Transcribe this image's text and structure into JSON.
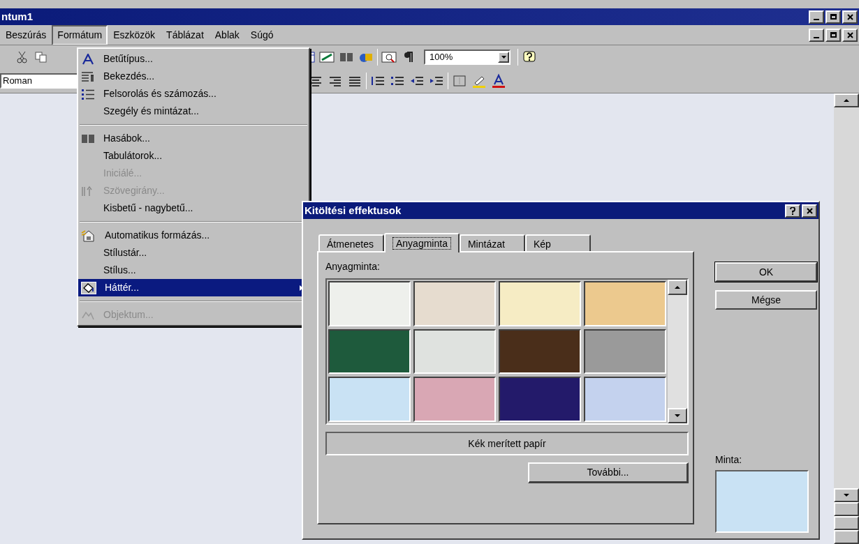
{
  "window": {
    "title": "ntum1"
  },
  "menu_bar": [
    {
      "label": "Beszúrás",
      "selected": false
    },
    {
      "label": "Formátum",
      "selected": true
    },
    {
      "label": "Eszközök",
      "selected": false
    },
    {
      "label": "Táblázat",
      "selected": false
    },
    {
      "label": "Ablak",
      "selected": false
    },
    {
      "label": "Súgó",
      "selected": false
    }
  ],
  "toolbar": {
    "font": "Roman",
    "zoom": "100%"
  },
  "format_menu": [
    {
      "items": [
        {
          "label": "Betűtípus...",
          "kind": "font",
          "disabled": false,
          "selected": false,
          "submenu": false
        },
        {
          "label": "Bekezdés...",
          "kind": "paragraph",
          "disabled": false,
          "selected": false,
          "submenu": false
        },
        {
          "label": "Felsorolás és számozás...",
          "kind": "list",
          "disabled": false,
          "selected": false,
          "submenu": false
        },
        {
          "label": "Szegély és mintázat...",
          "kind": "plain",
          "disabled": false,
          "selected": false,
          "submenu": false
        }
      ]
    },
    {
      "items": [
        {
          "label": "Hasábok...",
          "kind": "columns",
          "disabled": false,
          "selected": false,
          "submenu": false
        },
        {
          "label": "Tabulátorok...",
          "kind": "plain",
          "disabled": false,
          "selected": false,
          "submenu": false
        },
        {
          "label": "Iniciálé...",
          "kind": "plain",
          "disabled": true,
          "selected": false,
          "submenu": false
        },
        {
          "label": "Szövegirány...",
          "kind": "direction",
          "disabled": true,
          "selected": false,
          "submenu": false
        },
        {
          "label": "Kisbetű - nagybetű...",
          "kind": "plain",
          "disabled": false,
          "selected": false,
          "submenu": false
        }
      ]
    },
    {
      "items": [
        {
          "label": "Automatikus formázás...",
          "kind": "autoformat",
          "disabled": false,
          "selected": false,
          "submenu": false
        },
        {
          "label": "Stílustár...",
          "kind": "plain",
          "disabled": false,
          "selected": false,
          "submenu": false
        },
        {
          "label": "Stílus...",
          "kind": "plain",
          "disabled": false,
          "selected": false,
          "submenu": false
        },
        {
          "label": "Háttér...",
          "kind": "background",
          "disabled": false,
          "selected": true,
          "submenu": true
        }
      ]
    },
    {
      "items": [
        {
          "label": "Objektum...",
          "kind": "object",
          "disabled": true,
          "selected": false,
          "submenu": false
        }
      ]
    }
  ],
  "dialog": {
    "title": "Kitöltési effektusok",
    "tabs": [
      {
        "label": "Átmenetes",
        "selected": false
      },
      {
        "label": "Anyagminta",
        "selected": true
      },
      {
        "label": "Mintázat",
        "selected": false
      },
      {
        "label": "Kép",
        "selected": false
      }
    ],
    "texture_label": "Anyagminta:",
    "textures": [
      {
        "color": "#eef0ec"
      },
      {
        "color": "#e6dccf"
      },
      {
        "color": "#f6ecc4"
      },
      {
        "color": "#ecc98e"
      },
      {
        "color": "#1e5a3c"
      },
      {
        "color": "#dfe2df"
      },
      {
        "color": "#4a2e1a"
      },
      {
        "color": "#9a9a9a"
      },
      {
        "color": "#c9e2f4"
      },
      {
        "color": "#d9a7b4"
      },
      {
        "color": "#231a6a"
      },
      {
        "color": "#c4d2ee"
      }
    ],
    "texture_name": "Kék merített papír",
    "more_button": "További...",
    "ok_button": "OK",
    "cancel_button": "Mégse",
    "preview_label": "Minta:"
  }
}
